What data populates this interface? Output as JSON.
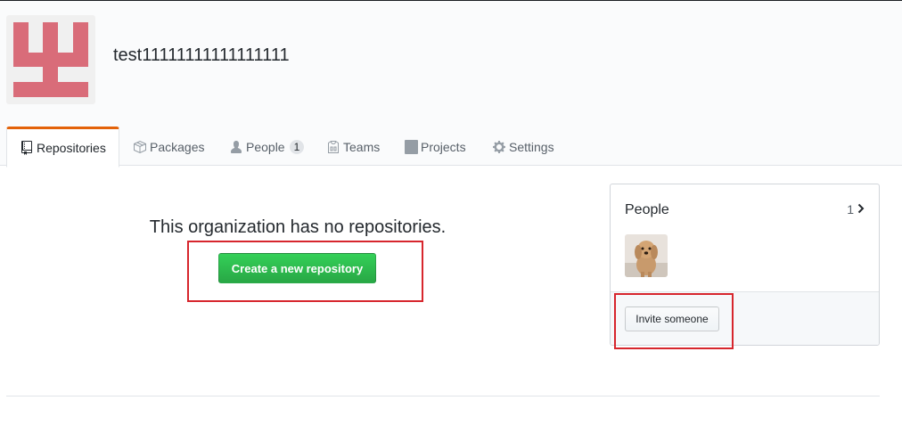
{
  "org": {
    "name": "test11111111111111111",
    "avatar_color": "#d96c79"
  },
  "tabs": [
    {
      "label": "Repositories",
      "icon": "repo-icon",
      "selected": true
    },
    {
      "label": "Packages",
      "icon": "package-icon"
    },
    {
      "label": "People",
      "icon": "person-icon",
      "counter": "1"
    },
    {
      "label": "Teams",
      "icon": "jersey-icon"
    },
    {
      "label": "Projects",
      "icon": "project-icon"
    },
    {
      "label": "Settings",
      "icon": "gear-icon"
    }
  ],
  "main": {
    "blank_title": "This organization has no repositories.",
    "create_button": "Create a new repository"
  },
  "people_box": {
    "title": "People",
    "count": "1",
    "invite_button": "Invite someone"
  },
  "colors": {
    "accent_tab": "#e36209",
    "primary_button": "#28a745",
    "highlight_box": "#d7262d"
  }
}
